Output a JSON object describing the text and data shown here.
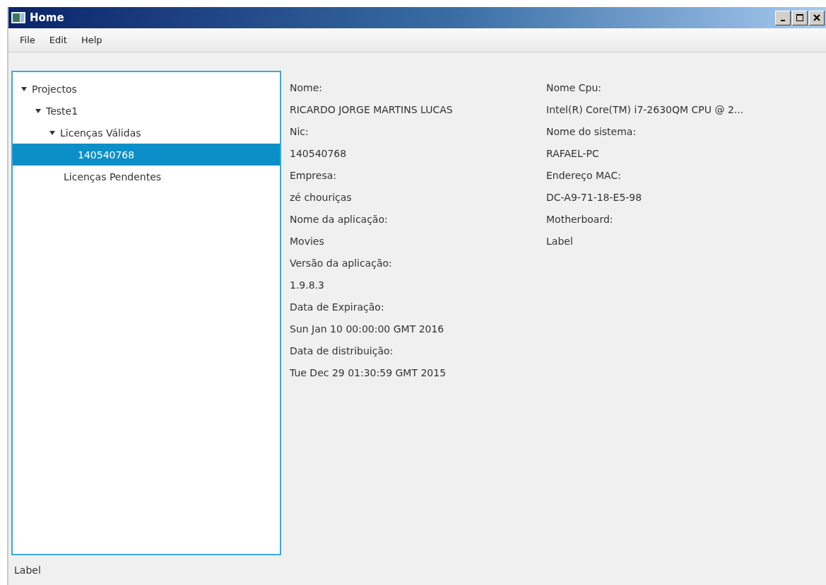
{
  "window": {
    "title": "Home"
  },
  "menu": [
    "File",
    "Edit",
    "Help"
  ],
  "tree": [
    {
      "label": "Projectos",
      "expanded": true,
      "selected": false,
      "children": [
        {
          "label": "Teste1",
          "expanded": true,
          "selected": false,
          "children": [
            {
              "label": "Licenças Válidas",
              "expanded": true,
              "selected": false,
              "children": [
                {
                  "label": "140540768",
                  "selected": true
                }
              ]
            },
            {
              "label": "Licenças Pendentes",
              "selected": false
            }
          ]
        }
      ]
    }
  ],
  "details": [
    [
      {
        "label": "Nome:",
        "value": "RICARDO JORGE MARTINS LUCAS"
      },
      {
        "label": "Nic:",
        "value": "140540768"
      },
      {
        "label": "Empresa:",
        "value": "zé chouriças"
      },
      {
        "label": "Nome da aplicação:",
        "value": "Movies"
      },
      {
        "label": "Versão da aplicação:",
        "value": "1.9.8.3"
      },
      {
        "label": "Data de Expiração:",
        "value": "Sun Jan 10 00:00:00 GMT 2016"
      },
      {
        "label": "Data de distribuição:",
        "value": "Tue Dec 29 01:30:59 GMT 2015"
      }
    ],
    [
      {
        "label": "Nome Cpu:",
        "value": "Intel(R) Core(TM) i7-2630QM CPU @ 2..."
      },
      {
        "label": "Nome do sistema:",
        "value": "RAFAEL-PC"
      },
      {
        "label": "Endereço MAC:",
        "value": "DC-A9-71-18-E5-98"
      },
      {
        "label": "Motherboard:",
        "value": "Label"
      }
    ]
  ],
  "status_bar": "Label"
}
